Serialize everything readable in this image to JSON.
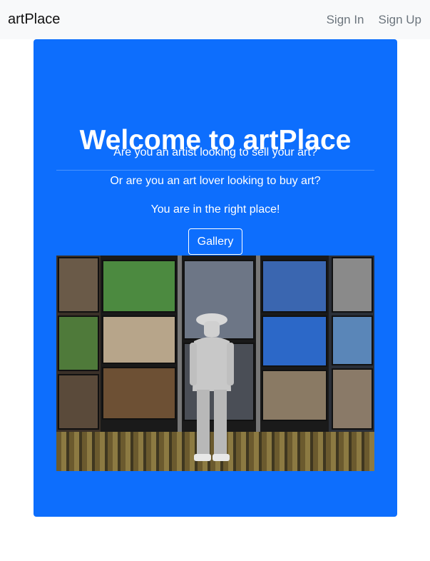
{
  "navbar": {
    "brand": "artPlace",
    "sign_in": "Sign In",
    "sign_up": "Sign Up"
  },
  "hero": {
    "title": "Welcome to artPlace",
    "line1": "Are you an artist looking to sell your art?",
    "line2": "Or are you an art lover looking to buy art?",
    "line3": "You are in the right place!",
    "gallery_button": "Gallery"
  },
  "colors": {
    "primary": "#0d6efd",
    "navbar_bg": "#f8f9fa",
    "nav_link": "#6c757d"
  }
}
